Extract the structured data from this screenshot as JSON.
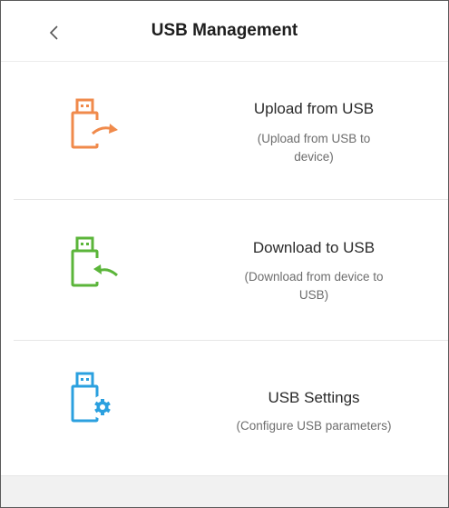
{
  "header": {
    "back_icon": "chevron-left-icon",
    "title": "USB Management"
  },
  "items": [
    {
      "label": "Upload from USB",
      "description": "(Upload from USB to device)",
      "desc_line1": "(Upload from USB to",
      "desc_line2": "device)",
      "icon": "usb-upload-icon",
      "color": "#f08a4b"
    },
    {
      "label": "Download to USB",
      "description": "(Download from device to USB)",
      "desc_line1": "(Download from device to",
      "desc_line2": "USB)",
      "icon": "usb-download-icon",
      "color": "#5bb53a"
    },
    {
      "label": "USB Settings",
      "description": "(Configure USB parameters)",
      "desc_line1": "(Configure USB parameters)",
      "icon": "usb-settings-icon",
      "color": "#2ba0df"
    }
  ]
}
